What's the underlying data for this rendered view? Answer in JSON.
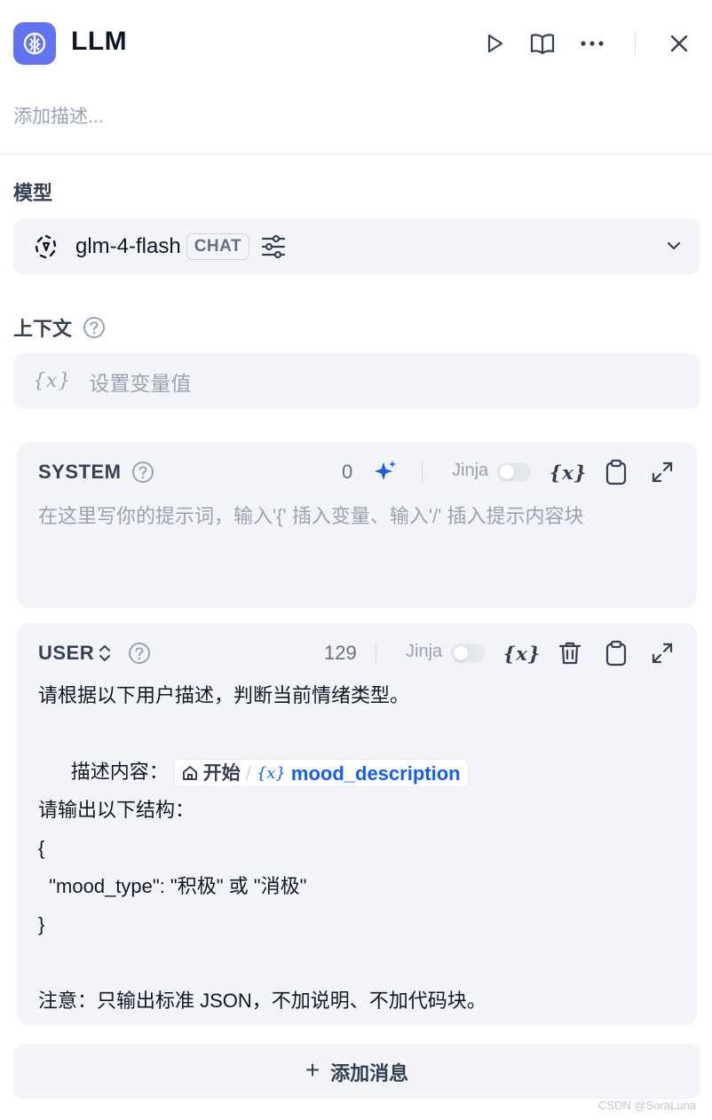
{
  "header": {
    "title": "LLM",
    "description_placeholder": "添加描述..."
  },
  "model": {
    "label": "模型",
    "name": "glm-4-flash",
    "badge": "CHAT"
  },
  "context": {
    "label": "上下文",
    "var_glyph": "{x}",
    "placeholder": "设置变量值"
  },
  "system_block": {
    "role": "SYSTEM",
    "count": "0",
    "jinja_label": "Jinja",
    "var_glyph": "{x}",
    "placeholder": "在这里写你的提示词，输入'{' 插入变量、输入'/' 插入提示内容块"
  },
  "user_block": {
    "role": "USER",
    "count": "129",
    "jinja_label": "Jinja",
    "var_glyph": "{x}",
    "lines": {
      "l1": "请根据以下用户描述，判断当前情绪类型。",
      "l2_prefix": "描述内容：",
      "l4": "请输出以下结构：",
      "l5": "{",
      "l6": "  \"mood_type\": \"积极\" 或 \"消极\"",
      "l7": "}",
      "l9": "注意：只输出标准 JSON，不加说明、不加代码块。"
    },
    "variable": {
      "node": "开始",
      "separator": "/",
      "glyph": "{x}",
      "name": "mood_description"
    }
  },
  "add_message": {
    "plus": "+",
    "label": "添加消息"
  },
  "watermark": "CSDN @SoraLuna",
  "colors": {
    "accent": "#6172f3",
    "variable_blue": "#155eef",
    "panel_bg": "#f2f4f7",
    "placeholder": "#98a2b3"
  },
  "icons": [
    "app-brain-icon",
    "play-icon",
    "book-icon",
    "more-icon",
    "close-icon",
    "model-logo-icon",
    "sliders-icon",
    "chevron-down-icon",
    "help-icon",
    "sparkle-icon",
    "clipboard-icon",
    "expand-icon",
    "trash-icon",
    "sort-icon",
    "home-icon"
  ]
}
